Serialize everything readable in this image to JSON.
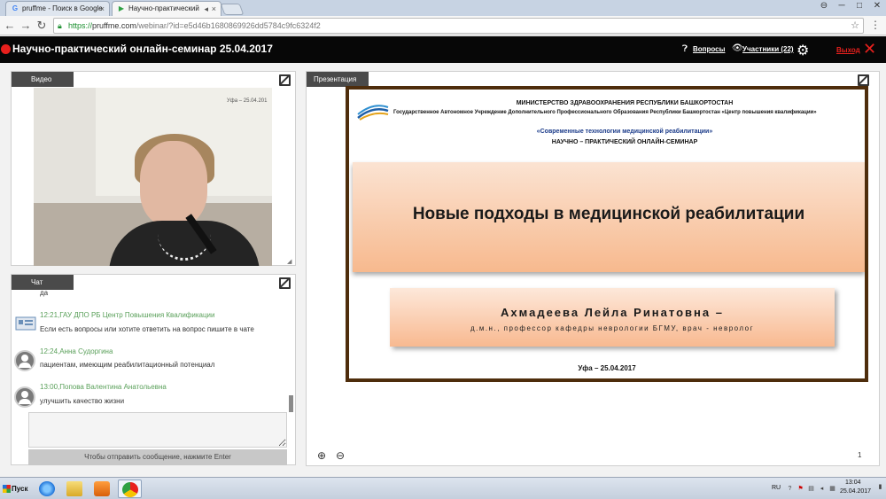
{
  "browser": {
    "tabs": [
      {
        "label": "pruffme - Поиск в Google",
        "favicon": "G",
        "favicon_color": "#4285f4"
      },
      {
        "label": "Научно-практический",
        "favicon": "▶",
        "favicon_color": "#2ea043"
      }
    ],
    "url": {
      "scheme": "https://",
      "host": "pruffme.com",
      "path": "/webinar/?id=e5d46b1680869926dd5784c9fc6324f2"
    },
    "window_controls": [
      "─",
      "□",
      "✕"
    ]
  },
  "app": {
    "title": "Научно-практический онлайн-семинар 25.04.2017",
    "questions_label": "Вопросы",
    "participants_label": "Участники (22)",
    "exit_label": "Выход",
    "accent_color": "#e8201d"
  },
  "video_panel": {
    "tab_label": "Видео",
    "screen_text": "Уфа – 25.04.201"
  },
  "chat_panel": {
    "tab_label": "Чат",
    "messages": [
      {
        "meta": "",
        "text": "да"
      },
      {
        "meta": "12:21,ГАУ ДПО РБ Центр Повышения Квалификации",
        "text": "Если есть вопросы или хотите ответить на вопрос пишите в чате"
      },
      {
        "meta": "12:24,Анна Судоргина",
        "text": "пациентам, имеющим реабилитационный потенциал"
      },
      {
        "meta": "13:00,Попова Валентина Анатольевна",
        "text": "улучшить качество жизни"
      }
    ],
    "send_hint": "Чтобы отправить сообщение, нажмите Enter"
  },
  "presentation": {
    "tab_label": "Презентация",
    "page_number": "1",
    "slide": {
      "ministry": "МИНИСТЕРСТВО ЗДРАВООХРАНЕНИЯ РЕСПУБЛИКИ БАШКОРТОСТАН",
      "institution": "Государственное Автономное Учреждение Дополнительного Профессионального Образования Республики Башкортостан «Центр повышения квалификации»",
      "theme": "«Современные технологии медицинской реабилитации»",
      "seminar": "НАУЧНО – ПРАКТИЧЕСКИЙ ОНЛАЙН-СЕМИНАР",
      "main_title": "Новые подходы в медицинской реабилитации",
      "speaker": "Ахмадеева Лейла Ринатовна –",
      "speaker_role": "д.м.н., профессор кафедры неврологии БГМУ, врач - невролог",
      "city_date": "Уфа – 25.04.2017"
    }
  },
  "taskbar": {
    "start_label": "Пуск",
    "lang": "RU",
    "time": "13:04",
    "date": "25.04.2017",
    "apps": [
      "ie-icon",
      "folder-icon",
      "media-player-icon",
      "chrome-icon"
    ]
  }
}
